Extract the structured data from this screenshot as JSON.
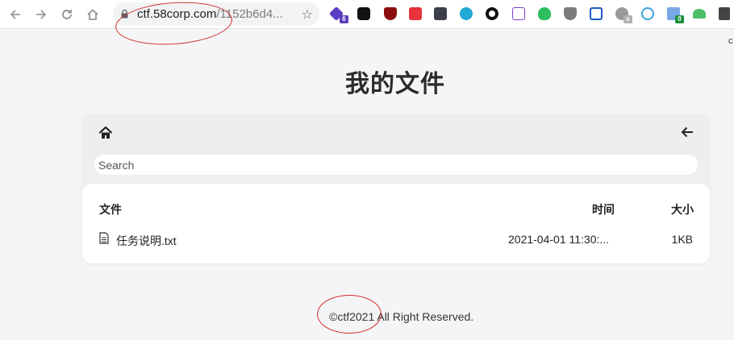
{
  "browser": {
    "url_host": "ctf.58corp.com",
    "url_path": "/1152b6d4...",
    "extension_badges": {
      "first": "6",
      "gray": "x",
      "green": "0"
    },
    "edge_letter": "c"
  },
  "page": {
    "title": "我的文件",
    "search_placeholder": "Search",
    "columns": {
      "file": "文件",
      "time": "时间",
      "size": "大小"
    },
    "files": [
      {
        "name": "任务说明.txt",
        "time": "2021-04-01 11:30:...",
        "size": "1KB"
      }
    ],
    "footer": "©ctf2021 All Right Reserved."
  },
  "colors": {
    "annotation": "#d42a2a",
    "background": "#f5f5f7"
  }
}
